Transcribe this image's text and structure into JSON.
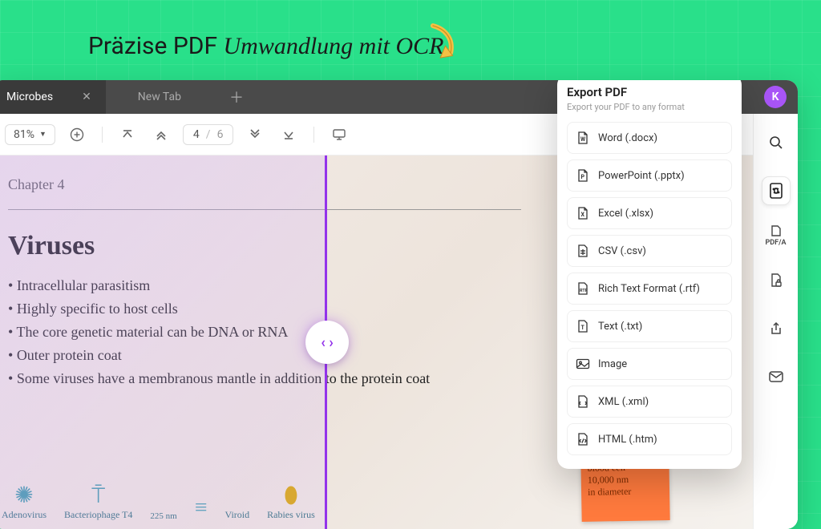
{
  "headline": {
    "plain": "Präzise PDF",
    "cursive": "Umwandlung mit OCR"
  },
  "tabs": {
    "active": "Microbes",
    "new": "New Tab"
  },
  "avatar_letter": "K",
  "toolbar": {
    "zoom": "81%",
    "page_current": "4",
    "page_total": "6"
  },
  "doc": {
    "chapter": "Chapter 4",
    "title": "Viruses",
    "bullets": [
      "Intracellular parasitism",
      "Highly specific to host cells",
      "The core genetic material can be DNA or RNA",
      "Outer protein coat",
      "Some viruses have a membranous mantle in addition to the protein coat"
    ],
    "strip": {
      "adeno": "Adenovirus",
      "bacterio": "Bacteriophage T4",
      "bacterio_size": "225 nm",
      "viroid": "Viroid",
      "rabies": "Rabies virus"
    },
    "sticky": {
      "l1": "blood cell",
      "l2": "10,000 nm",
      "l3": "in diameter"
    }
  },
  "export": {
    "title": "Export PDF",
    "subtitle": "Export your PDF to any format",
    "items": [
      "Word (.docx)",
      "PowerPoint (.pptx)",
      "Excel (.xlsx)",
      "CSV (.csv)",
      "Rich Text Format (.rtf)",
      "Text (.txt)",
      "Image",
      "XML (.xml)",
      "HTML (.htm)"
    ]
  },
  "rail": {
    "pdfa": "PDF/A"
  }
}
